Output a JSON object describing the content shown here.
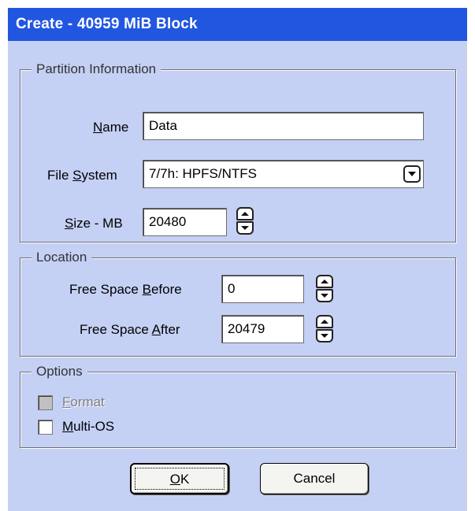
{
  "dialog": {
    "title": "Create - 40959 MiB Block"
  },
  "partition_info": {
    "legend": "Partition Information",
    "name_label_key": "N",
    "name_label_rest": "ame",
    "name_value": "Data",
    "fs_label_pre": "File ",
    "fs_label_key": "S",
    "fs_label_rest": "ystem",
    "fs_value": "7/7h: HPFS/NTFS",
    "size_label_key": "S",
    "size_label_rest": "ize - MB",
    "size_value": "20480"
  },
  "location": {
    "legend": "Location",
    "before_label_pre": "Free Space ",
    "before_label_key": "B",
    "before_label_rest": "efore",
    "before_value": "0",
    "after_label_pre": "Free Space ",
    "after_label_key": "A",
    "after_label_rest": "fter",
    "after_value": "20479"
  },
  "options": {
    "legend": "Options",
    "format_key": "F",
    "format_rest": "ormat",
    "format_checked": false,
    "format_enabled": false,
    "multios_key": "M",
    "multios_rest": "ulti-OS",
    "multios_checked": false
  },
  "buttons": {
    "ok_key": "O",
    "ok_rest": "K",
    "cancel": "Cancel"
  }
}
